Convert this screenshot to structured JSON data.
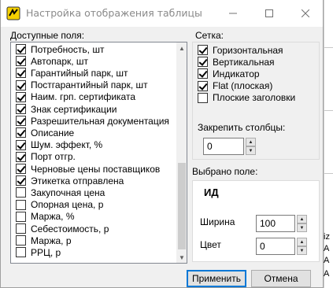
{
  "window": {
    "title": "Настройка отображения таблицы"
  },
  "fields": {
    "label": "Доступные поля:",
    "items": [
      {
        "label": "Потребность, шт",
        "checked": true
      },
      {
        "label": "Автопарк, шт",
        "checked": true
      },
      {
        "label": "Гарантийный парк, шт",
        "checked": true
      },
      {
        "label": "Постгарантийный парк, шт",
        "checked": true
      },
      {
        "label": "Наим. грп. сертификата",
        "checked": true
      },
      {
        "label": "Знак сертификации",
        "checked": true
      },
      {
        "label": "Разрешительная документация",
        "checked": true
      },
      {
        "label": "Описание",
        "checked": true
      },
      {
        "label": "Шум. эффект, %",
        "checked": true
      },
      {
        "label": "Порт отгр.",
        "checked": true
      },
      {
        "label": "Черновые цены поставщиков",
        "checked": true
      },
      {
        "label": "Этикетка отправлена",
        "checked": true
      },
      {
        "label": "Закупочная цена",
        "checked": false
      },
      {
        "label": "Опорная цена, р",
        "checked": false
      },
      {
        "label": "Маржа, %",
        "checked": false
      },
      {
        "label": "Себестоимость, р",
        "checked": false
      },
      {
        "label": "Маржа, р",
        "checked": false
      },
      {
        "label": "РРЦ, р",
        "checked": false
      }
    ]
  },
  "grid": {
    "label": "Сетка:",
    "items": [
      {
        "label": "Горизонтальная",
        "checked": true
      },
      {
        "label": "Вертикальная",
        "checked": true
      },
      {
        "label": "Индикатор",
        "checked": true
      },
      {
        "label": "Flat (плоская)",
        "checked": true
      },
      {
        "label": "Плоские заголовки",
        "checked": false
      }
    ],
    "freeze_label": "Закрепить столбцы:",
    "freeze_value": "0"
  },
  "selected": {
    "label": "Выбрано поле:",
    "field_name": "ИД",
    "width_label": "Ширина",
    "width_value": "100",
    "color_label": "Цвет",
    "color_value": "0"
  },
  "buttons": {
    "apply": "Применить",
    "cancel": "Отмена"
  },
  "background_fragments": [
    "iz",
    "А",
    "А",
    "А"
  ]
}
